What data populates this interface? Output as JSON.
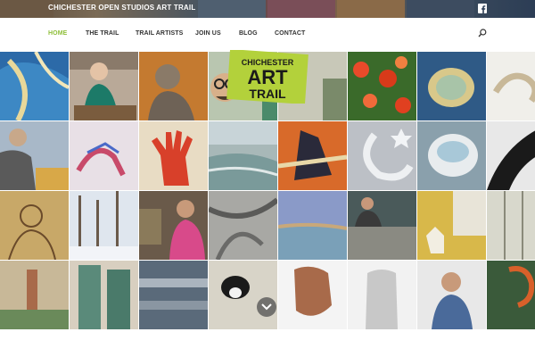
{
  "header": {
    "site_title": "CHICHESTER OPEN STUDIOS ART TRAIL",
    "facebook_icon": "facebook-icon"
  },
  "nav": {
    "items": [
      {
        "label": "HOME",
        "active": true
      },
      {
        "label": "THE TRAIL",
        "active": false
      },
      {
        "label": "TRAIL ARTISTS",
        "active": false
      },
      {
        "label": "JOIN US",
        "active": false
      },
      {
        "label": "BLOG",
        "active": false
      },
      {
        "label": "CONTACT",
        "active": false
      }
    ],
    "search_icon": "search-icon",
    "active_color": "#8fbf3a"
  },
  "logo": {
    "line1": "CHICHESTER",
    "line2": "ART",
    "line3": "TRAIL",
    "color": "#b3d13b"
  },
  "scroll_icon": "chevron-down-icon"
}
